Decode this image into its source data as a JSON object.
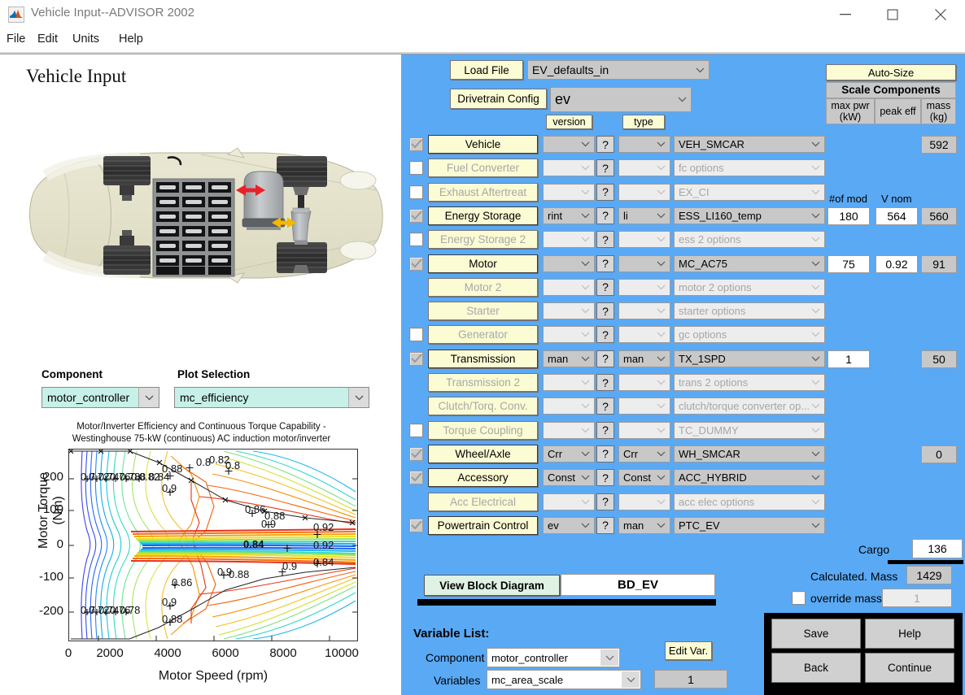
{
  "window": {
    "title": "Vehicle Input--ADVISOR 2002",
    "minimize_icon": "minimize-icon",
    "maximize_icon": "maximize-icon",
    "close_icon": "close-icon",
    "resize_glyph": "↘"
  },
  "menu": {
    "items": [
      "File",
      "Edit",
      "Units",
      "Help"
    ]
  },
  "left": {
    "page_title": "Vehicle Input",
    "diagram_name": "ev-vehicle-cutaway-diagram",
    "component_label": "Component",
    "component_value": "motor_controller",
    "plot_selection_label": "Plot Selection",
    "plot_selection_value": "mc_efficiency"
  },
  "chart_data": {
    "type": "line",
    "title": "Motor/Inverter Efficiency and Continuous Torque Capability -",
    "subtitle": "Westinghouse 75-kW (continuous) AC induction motor/inverter",
    "xlabel": "Motor Speed (rpm)",
    "ylabel": "Motor Torque (Nm)",
    "xlim": [
      0,
      10000
    ],
    "ylim": [
      -260,
      260
    ],
    "xticks": [
      0,
      2000,
      4000,
      6000,
      8000,
      10000
    ],
    "yticks": [
      200,
      100,
      0,
      -100,
      -200
    ],
    "ytick_labels": [
      "200",
      "100",
      "0",
      "-100",
      "-200"
    ],
    "grid": false,
    "legend": "none",
    "contour_levels": [
      0.7,
      0.72,
      0.74,
      0.76,
      0.78,
      0.8,
      0.82,
      0.84,
      0.86,
      0.88,
      0.9,
      0.92
    ],
    "contour_label_values": [
      "0.7",
      "0.72",
      "0.74",
      "0.76",
      "0.78",
      "0.8",
      "0.82",
      "0.84",
      "0.86",
      "0.88",
      "0.9",
      "0.92"
    ],
    "envelope_note": "continuous torque capability envelope (black line with x markers)",
    "annotations": [
      "0.88",
      "0.82",
      "0.8",
      "0.9",
      "0.86",
      "0.88",
      "0.9",
      "0.92",
      "0.84",
      "0.92",
      "0.84",
      "0.9",
      "0.88",
      "0.86"
    ]
  },
  "right": {
    "load_file_button": "Load File",
    "load_file_value": "EV_defaults_in",
    "drivetrain_button": "Drivetrain Config",
    "drivetrain_value": "ev",
    "version_header": "version",
    "type_header": "type",
    "autosize_button": "Auto-Size",
    "scale_components_header": "Scale Components",
    "col_maxpwr": "max pwr\n(kW)",
    "col_maxpwr_l1": "max pwr",
    "col_maxpwr_l2": "(kW)",
    "col_peakeff": "peak eff",
    "col_mass_l1": "mass",
    "col_mass_l2": "(kg)",
    "num_mod_label": "#of mod",
    "vnom_label": "V nom",
    "rows": [
      {
        "name": "Vehicle",
        "checked": true,
        "enabled": true,
        "version": "",
        "type": "",
        "options": "VEH_SMCAR",
        "maxpwr": "",
        "peakeff": "",
        "mass": "592"
      },
      {
        "name": "Fuel Converter",
        "checked": false,
        "enabled": false,
        "version": "",
        "type": "",
        "options": "fc options",
        "maxpwr": "",
        "peakeff": "",
        "mass": ""
      },
      {
        "name": "Exhaust Aftertreat",
        "checked": false,
        "enabled": false,
        "version": "",
        "type": "",
        "options": "EX_CI",
        "maxpwr": "",
        "peakeff": "",
        "mass": ""
      },
      {
        "name": "Energy Storage",
        "checked": true,
        "enabled": true,
        "version": "rint",
        "type": "li",
        "options": "ESS_LI160_temp",
        "maxpwr": "180",
        "peakeff": "564",
        "mass": "560"
      },
      {
        "name": "Energy Storage 2",
        "checked": false,
        "enabled": false,
        "version": "",
        "type": "",
        "options": "ess 2 options",
        "maxpwr": "",
        "peakeff": "",
        "mass": ""
      },
      {
        "name": "Motor",
        "checked": true,
        "enabled": true,
        "version": "",
        "type": "",
        "options": "MC_AC75",
        "maxpwr": "75",
        "peakeff": "0.92",
        "mass": "91"
      },
      {
        "name": "Motor 2",
        "checked": null,
        "enabled": false,
        "version": "",
        "type": "",
        "options": "motor 2 options",
        "maxpwr": "",
        "peakeff": "",
        "mass": ""
      },
      {
        "name": "Starter",
        "checked": null,
        "enabled": false,
        "version": "",
        "type": "",
        "options": "starter options",
        "maxpwr": "",
        "peakeff": "",
        "mass": ""
      },
      {
        "name": "Generator",
        "checked": false,
        "enabled": false,
        "version": "",
        "type": "",
        "options": "gc options",
        "maxpwr": "",
        "peakeff": "",
        "mass": ""
      },
      {
        "name": "Transmission",
        "checked": true,
        "enabled": true,
        "version": "man",
        "type": "man",
        "options": "TX_1SPD",
        "maxpwr": "1",
        "peakeff": "",
        "mass": "50"
      },
      {
        "name": "Transmission 2",
        "checked": null,
        "enabled": false,
        "version": "",
        "type": "",
        "options": "trans 2 options",
        "maxpwr": "",
        "peakeff": "",
        "mass": ""
      },
      {
        "name": "Clutch/Torq. Conv.",
        "checked": null,
        "enabled": false,
        "version": "",
        "type": "",
        "options": "clutch/torque converter op...",
        "maxpwr": "",
        "peakeff": "",
        "mass": ""
      },
      {
        "name": "Torque Coupling",
        "checked": false,
        "enabled": false,
        "version": "",
        "type": "",
        "options": "TC_DUMMY",
        "maxpwr": "",
        "peakeff": "",
        "mass": ""
      },
      {
        "name": "Wheel/Axle",
        "checked": true,
        "enabled": true,
        "version": "Crr",
        "type": "Crr",
        "options": "WH_SMCAR",
        "maxpwr": "",
        "peakeff": "",
        "mass": "0"
      },
      {
        "name": "Accessory",
        "checked": true,
        "enabled": true,
        "version": "Const",
        "type": "Const",
        "options": "ACC_HYBRID",
        "maxpwr": "",
        "peakeff": "",
        "mass": ""
      },
      {
        "name": "Acc Electrical",
        "checked": null,
        "enabled": false,
        "version": "",
        "type": "",
        "options": "acc elec options",
        "maxpwr": "",
        "peakeff": "",
        "mass": ""
      },
      {
        "name": "Powertrain Control",
        "checked": true,
        "enabled": true,
        "version": "ev",
        "type": "man",
        "options": "PTC_EV",
        "maxpwr": "",
        "peakeff": "",
        "mass": ""
      }
    ],
    "help_marker": "?",
    "cargo_label": "Cargo",
    "cargo_value": "136",
    "calc_mass_label": "Calculated. Mass",
    "calc_mass_value": "1429",
    "override_mass_label": "override mass",
    "override_mass_value": "1",
    "override_checked": false,
    "view_block_diagram_button": "View Block Diagram",
    "block_diagram_value": "BD_EV",
    "variable_list_label": "Variable List:",
    "var_component_label": "Component",
    "var_component_value": "motor_controller",
    "var_variables_label": "Variables",
    "var_variables_value": "mc_area_scale",
    "var_value": "1",
    "edit_var_button": "Edit Var.",
    "save_button": "Save",
    "help_button": "Help",
    "back_button": "Back",
    "continue_button": "Continue"
  },
  "colors": {
    "panel_blue": "#5aa9f5",
    "button_yellow": "#fbfbd4",
    "teal_select": "#c6f0e8",
    "grey_field": "#c8c8c8"
  }
}
